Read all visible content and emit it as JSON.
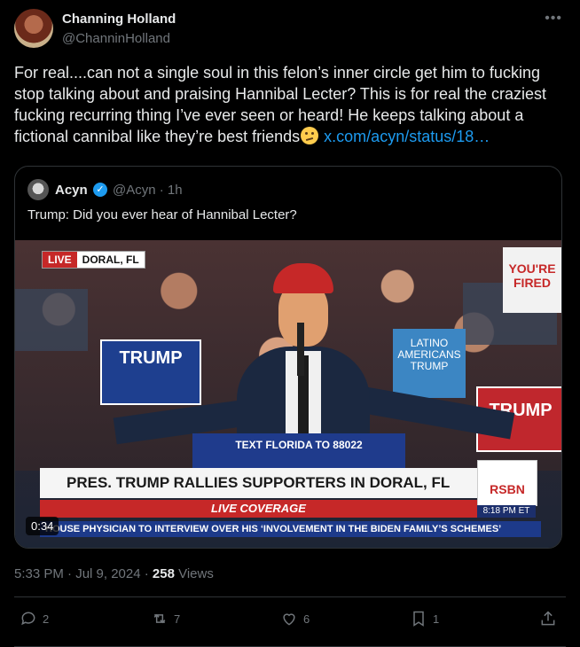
{
  "author": {
    "name": "Channing Holland",
    "handle": "@ChanninHolland"
  },
  "post": {
    "text": "For real....can not a single soul in this felon’s inner circle get him to fucking stop talking about and praising Hannibal Lecter? This is for real the craziest fucking recurring thing I’ve ever seen or heard! He keeps talking about a fictional cannibal like they’re best friends",
    "link": "x.com/acyn/status/18…",
    "timestamp": "5:33 PM · Jul 9, 2024 · ",
    "views_count": "258",
    "views_label": " Views"
  },
  "quote": {
    "name": "Acyn",
    "handle": "@Acyn · 1h",
    "text": "Trump: Did you ever hear of Hannibal Lecter?",
    "video": {
      "live_label": "LIVE",
      "location": "DORAL, FL",
      "headline": "PRES. TRUMP RALLIES SUPPORTERS IN DORAL, FL",
      "live_coverage": "LIVE COVERAGE",
      "network": "RSBN",
      "time": "8:18 PM ET",
      "ticker": "HOUSE PHYSICIAN TO INTERVIEW OVER HIS ‘INVOLVEMENT IN THE BIDEN FAMILY’S SCHEMES’",
      "duration": "0:34",
      "sign_trump": "TRUMP",
      "sign_latinos": "LATINO AMERICANS TRUMP",
      "sign_crooked": "YOU'RE FIRED",
      "sign_right": "TRUMP",
      "podium_text": "TEXT FLORIDA TO 88022"
    }
  },
  "actions": {
    "replies": "2",
    "reposts": "7",
    "likes": "6",
    "bookmarks": "1"
  },
  "colors": {
    "background": "#000000",
    "text": "#e7e9ea",
    "muted": "#71767b",
    "accent": "#1d9bf0",
    "border": "#2f3336"
  }
}
